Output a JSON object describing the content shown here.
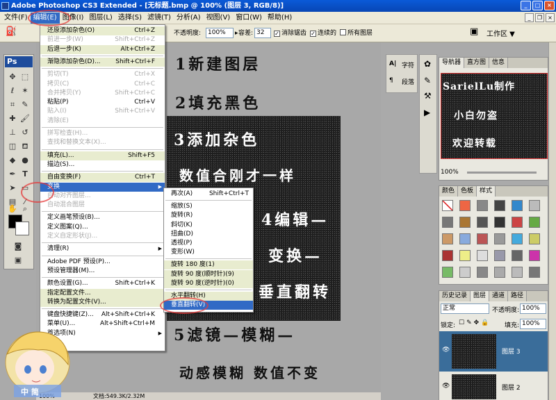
{
  "window": {
    "title": "Adobe Photoshop CS3 Extended - [无标题.bmp @ 100% (图层 3, RGB/8)]"
  },
  "menubar": {
    "items": [
      "文件(F)",
      "编辑(E)",
      "图像(I)",
      "图层(L)",
      "选择(S)",
      "滤镜(T)",
      "分析(A)",
      "视图(V)",
      "窗口(W)",
      "帮助(H)"
    ],
    "active_index": 1
  },
  "options": {
    "opacity_label": "不透明度:",
    "opacity_value": "100%",
    "tolerance_label": "容差:",
    "tolerance_value": "32",
    "antialias_label": "消除锯齿",
    "contiguous_label": "连续的",
    "all_layers_label": "所有图层",
    "workspace_label": "工作区 ▼"
  },
  "edit_menu": [
    {
      "label": "还原添加杂色(O)",
      "shortcut": "Ctrl+Z",
      "state": "hl"
    },
    {
      "label": "前进一步(W)",
      "shortcut": "Shift+Ctrl+Z",
      "state": "dis"
    },
    {
      "label": "后退一步(K)",
      "shortcut": "Alt+Ctrl+Z",
      "state": "hl"
    },
    {
      "sep": true
    },
    {
      "label": "渐隐添加杂色(D)...",
      "shortcut": "Shift+Ctrl+F",
      "state": "hl"
    },
    {
      "sep": true
    },
    {
      "label": "剪切(T)",
      "shortcut": "Ctrl+X",
      "state": "dis"
    },
    {
      "label": "拷贝(C)",
      "shortcut": "Ctrl+C",
      "state": "dis"
    },
    {
      "label": "合并拷贝(Y)",
      "shortcut": "Shift+Ctrl+C",
      "state": "dis"
    },
    {
      "label": "粘贴(P)",
      "shortcut": "Ctrl+V",
      "state": ""
    },
    {
      "label": "贴入(I)",
      "shortcut": "Shift+Ctrl+V",
      "state": "dis"
    },
    {
      "label": "清除(E)",
      "shortcut": "",
      "state": "dis"
    },
    {
      "sep": true
    },
    {
      "label": "拼写检查(H)...",
      "shortcut": "",
      "state": "dis"
    },
    {
      "label": "查找和替换文本(X)...",
      "shortcut": "",
      "state": "dis"
    },
    {
      "sep": true
    },
    {
      "label": "填充(L)...",
      "shortcut": "Shift+F5",
      "state": "hl"
    },
    {
      "label": "描边(S)...",
      "shortcut": "",
      "state": ""
    },
    {
      "sep": true
    },
    {
      "label": "自由变换(F)",
      "shortcut": "Ctrl+T",
      "state": "hl"
    },
    {
      "label": "变换",
      "shortcut": "",
      "state": "sel",
      "submenu": true
    },
    {
      "label": "自动对齐图层...",
      "shortcut": "",
      "state": "dis"
    },
    {
      "label": "自动混合图层",
      "shortcut": "",
      "state": "dis"
    },
    {
      "sep": true
    },
    {
      "label": "定义画笔预设(B)...",
      "shortcut": "",
      "state": ""
    },
    {
      "label": "定义图案(Q)...",
      "shortcut": "",
      "state": ""
    },
    {
      "label": "定义自定形状(J)...",
      "shortcut": "",
      "state": "dis"
    },
    {
      "sep": true
    },
    {
      "label": "清理(R)",
      "shortcut": "",
      "state": "",
      "submenu": true
    },
    {
      "sep": true
    },
    {
      "label": "Adobe PDF 预设(P)...",
      "shortcut": "",
      "state": ""
    },
    {
      "label": "预设管理器(M)...",
      "shortcut": "",
      "state": ""
    },
    {
      "sep": true
    },
    {
      "label": "颜色设置(G)...",
      "shortcut": "Shift+Ctrl+K",
      "state": ""
    },
    {
      "label": "指定配置文件...",
      "shortcut": "",
      "state": "hl"
    },
    {
      "label": "转换为配置文件(V)...",
      "shortcut": "",
      "state": "hl"
    },
    {
      "sep": true
    },
    {
      "label": "键盘快捷键(Z)...",
      "shortcut": "Alt+Shift+Ctrl+K",
      "state": ""
    },
    {
      "label": "菜单(U)...",
      "shortcut": "Alt+Shift+Ctrl+M",
      "state": ""
    },
    {
      "label": "首选项(N)",
      "shortcut": "",
      "state": "",
      "submenu": true
    }
  ],
  "transform_menu": [
    {
      "label": "再次(A)",
      "shortcut": "Shift+Ctrl+T",
      "state": ""
    },
    {
      "sep": true
    },
    {
      "label": "缩放(S)",
      "shortcut": "",
      "state": ""
    },
    {
      "label": "旋转(R)",
      "shortcut": "",
      "state": ""
    },
    {
      "label": "斜切(K)",
      "shortcut": "",
      "state": ""
    },
    {
      "label": "扭曲(D)",
      "shortcut": "",
      "state": ""
    },
    {
      "label": "透视(P)",
      "shortcut": "",
      "state": ""
    },
    {
      "label": "变形(W)",
      "shortcut": "",
      "state": ""
    },
    {
      "sep": true
    },
    {
      "label": "旋转 180 度(1)",
      "shortcut": "",
      "state": "hl"
    },
    {
      "label": "旋转 90 度(顺时针)(9)",
      "shortcut": "",
      "state": "hl"
    },
    {
      "label": "旋转 90 度(逆时针)(0)",
      "shortcut": "",
      "state": "hl"
    },
    {
      "sep": true
    },
    {
      "label": "水平翻转(H)",
      "shortcut": "",
      "state": "hl"
    },
    {
      "label": "垂直翻转(V)",
      "shortcut": "",
      "state": "sel"
    }
  ],
  "canvas_text": {
    "step1": "1新建图层",
    "step2": "2填充黑色",
    "step3": "3添加杂色",
    "step3b": "数值合刚才一样",
    "step4": "4编辑—",
    "step4b": "变换—",
    "step4c": "垂直翻转",
    "step5": "5滤镜—模糊—",
    "step5b": "动感模糊  数值不变"
  },
  "status": {
    "text": "文档:549.3K/2.32M",
    "zoom": "100%"
  },
  "side_panel": {
    "char_label": "字符",
    "para_label": "段落"
  },
  "navigator": {
    "tabs": [
      "导航器",
      "直方图",
      "信息"
    ],
    "zoom": "100%",
    "preview_lines": [
      "SarielLu制作",
      "小白勿盗",
      "欢迎转载"
    ]
  },
  "color_panel": {
    "tabs": [
      "颜色",
      "色板",
      "样式"
    ]
  },
  "layers_panel": {
    "tabs": [
      "历史记录",
      "图层",
      "通道",
      "路径"
    ],
    "blend_mode": "正常",
    "opacity_label": "不透明度:",
    "opacity_value": "100%",
    "lock_label": "锁定:",
    "fill_label": "填充:",
    "fill_value": "100%",
    "layers": [
      "图层 3",
      "图层 2"
    ]
  },
  "avatar": {
    "caption": "中 简"
  },
  "colors": {
    "accent": "#316ac5",
    "highlight": "#e8eccf",
    "titlebar": "#0a5ad8",
    "layer_selected": "#3a6d9a"
  }
}
